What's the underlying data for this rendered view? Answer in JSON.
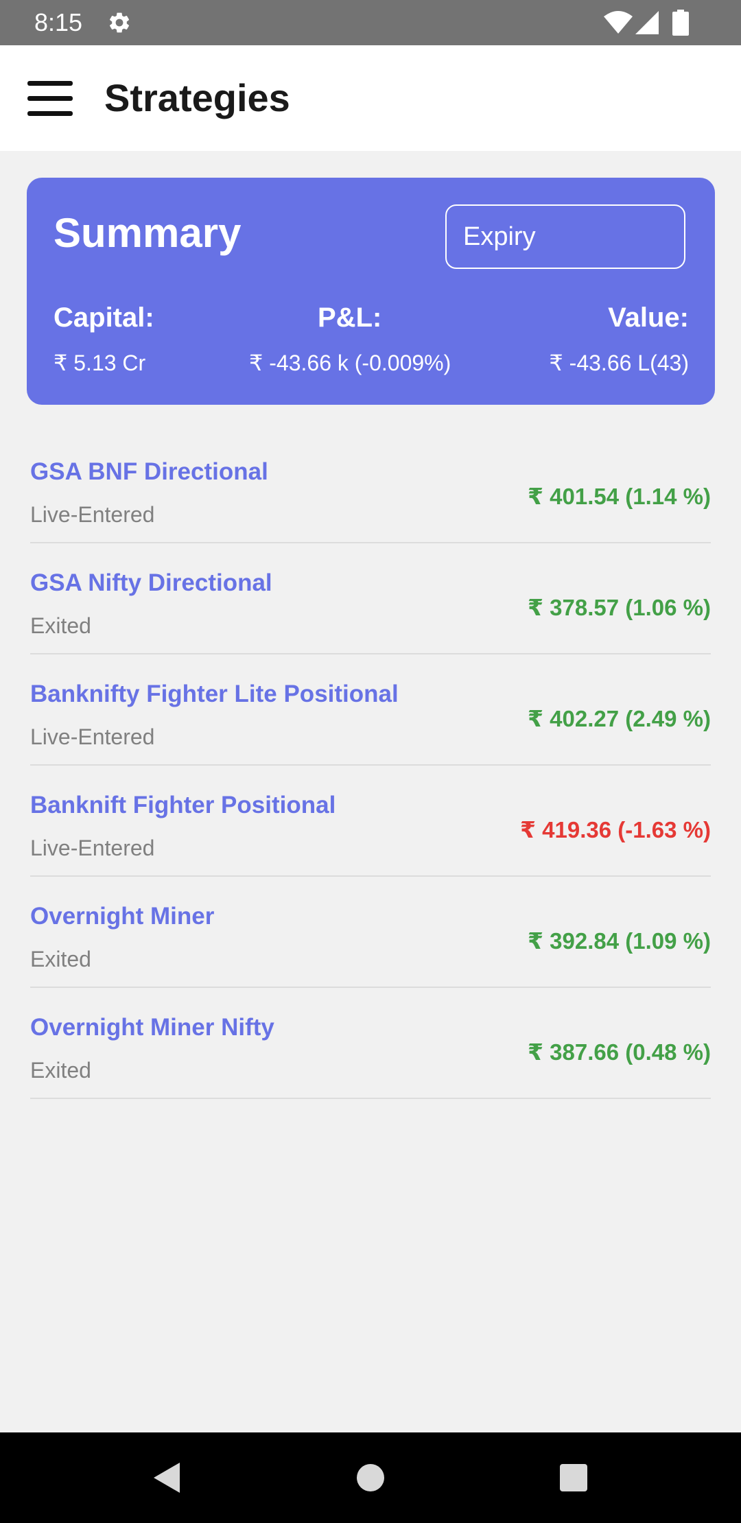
{
  "status_bar": {
    "time": "8:15",
    "icons": [
      "gear-icon",
      "wifi-icon",
      "signal-icon",
      "battery-icon"
    ]
  },
  "app_bar": {
    "title": "Strategies",
    "menu_icon": "hamburger-menu-icon"
  },
  "summary": {
    "heading": "Summary",
    "expiry_placeholder": "Expiry",
    "capital_label": "Capital:",
    "capital_value": "₹ 5.13 Cr",
    "pnl_label": "P&L:",
    "pnl_value": "₹ -43.66 k (-0.009%)",
    "value_label": "Value:",
    "value_value": "₹ -43.66 L(43)",
    "card_color": "#6772e5"
  },
  "strategies": [
    {
      "name": "GSA BNF Directional",
      "status": "Live-Entered",
      "pnl": "₹ 401.54 (1.14 %)",
      "trend": "positive"
    },
    {
      "name": "GSA Nifty Directional",
      "status": "Exited",
      "pnl": "₹ 378.57 (1.06 %)",
      "trend": "positive"
    },
    {
      "name": "Banknifty Fighter Lite Positional",
      "status": "Live-Entered",
      "pnl": "₹ 402.27 (2.49 %)",
      "trend": "positive"
    },
    {
      "name": "Banknift Fighter Positional",
      "status": "Live-Entered",
      "pnl": "₹ 419.36 (-1.63 %)",
      "trend": "negative"
    },
    {
      "name": "Overnight Miner",
      "status": "Exited",
      "pnl": "₹ 392.84 (1.09 %)",
      "trend": "positive"
    },
    {
      "name": "Overnight Miner Nifty",
      "status": "Exited",
      "pnl": "₹ 387.66 (0.48 %)",
      "trend": "positive"
    }
  ],
  "colors": {
    "accent": "#6772e5",
    "positive": "#43a047",
    "negative": "#e53935"
  },
  "nav_bar": {
    "icons": [
      "back-icon",
      "home-icon",
      "recents-icon"
    ]
  }
}
